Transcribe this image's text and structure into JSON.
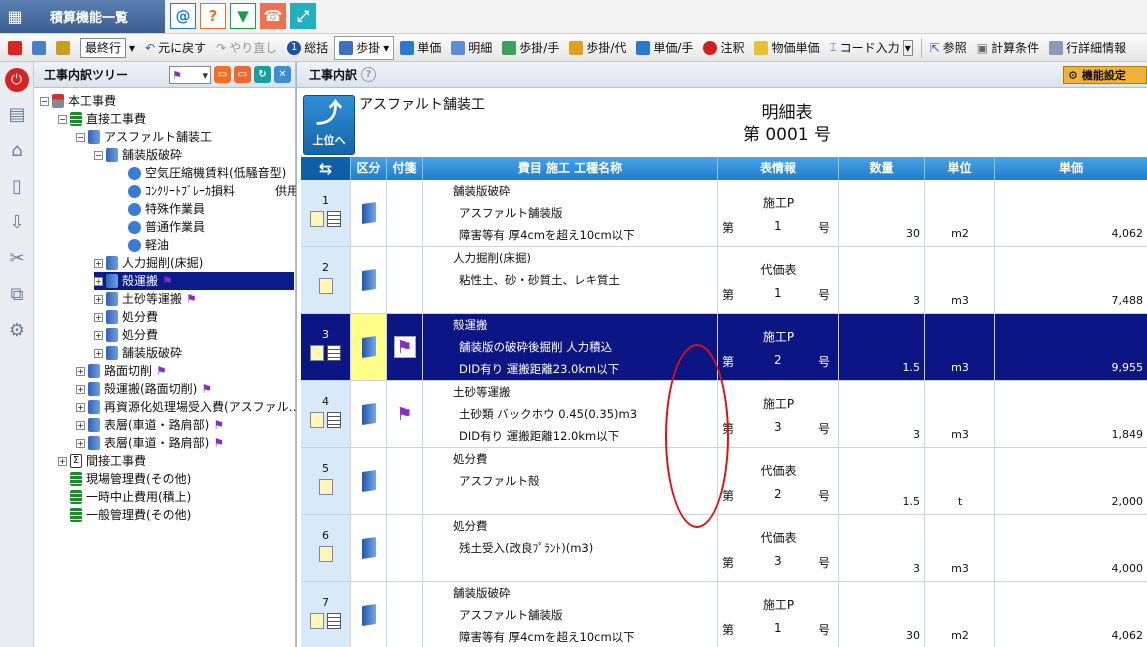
{
  "app": {
    "title": "積算機能一覧"
  },
  "toolbar": {
    "sel": "最終行",
    "undo": "元に戻す",
    "redo": "やり直し",
    "total": "総括",
    "ayumi": "歩掛",
    "tanka": "単価",
    "meisai": "明細",
    "ayumi_hand": "歩掛/手",
    "ayumi_dai": "歩掛/代",
    "tanka_hand": "単価/手",
    "chuushaku": "注釈",
    "buppin": "物価単価",
    "code_input": "コード入力",
    "sansho": "参照",
    "keisan": "計算条件",
    "gyoshosai": "行詳細情報"
  },
  "tree": {
    "header": "工事内訳ツリー",
    "nodes": [
      {
        "label": "本工事費"
      },
      {
        "label": "直接工事費"
      },
      {
        "label": "アスファルト舗装工"
      },
      {
        "label": "舗装版破砕"
      },
      {
        "label": "空気圧縮機賃料(低騒音型)"
      },
      {
        "label": "ｺﾝｸﾘｰﾄﾌﾞﾚｰｶ損料"
      },
      {
        "label": "特殊作業員"
      },
      {
        "label": "普通作業員"
      },
      {
        "label": "軽油"
      },
      {
        "label": "人力掘削(床掘)"
      },
      {
        "label": "殻運搬"
      },
      {
        "label": "土砂等運搬"
      },
      {
        "label": "処分費"
      },
      {
        "label": "処分費"
      },
      {
        "label": "舗装版破砕"
      },
      {
        "label": "路面切削"
      },
      {
        "label": "殻運搬(路面切削)"
      },
      {
        "label": "再資源化処理場受入費(アスファル…"
      },
      {
        "label": "表層(車道・路肩部)"
      },
      {
        "label": "表層(車道・路肩部)"
      },
      {
        "label": "間接工事費"
      },
      {
        "label": "現場管理費(その他)"
      },
      {
        "label": "一時中止費用(積上)"
      },
      {
        "label": "一般管理費(その他)"
      }
    ],
    "extra_suffix": "供用"
  },
  "main": {
    "header": "工事内訳",
    "kinou": "機能設定",
    "up_label": "上位へ",
    "sheet_name": "アスファルト舗装工",
    "sheet_title1": "明細表",
    "sheet_title2": "第 0001 号",
    "columns": {
      "swap": "⇆",
      "kubun": "区分",
      "fusen": "付箋",
      "name": "費目 施工 工種名称",
      "info": "表情報",
      "qty": "数量",
      "unit": "単位",
      "price": "単価"
    },
    "rows": [
      {
        "no": "1",
        "l1": "舗装版破砕",
        "l2": "アスファルト舗装版",
        "l3": "障害等有 厚4cmを超え10cm以下",
        "kind": "施工P",
        "dai": "第",
        "num": "1",
        "go": "号",
        "qty": "30",
        "unit": "m2",
        "price": "4,062"
      },
      {
        "no": "2",
        "l1": "人力掘削(床掘)",
        "l2": "",
        "l3": "粘性土、砂・砂質土、レキ質土",
        "kind": "代価表",
        "dai": "第",
        "num": "1",
        "go": "号",
        "qty": "3",
        "unit": "m3",
        "price": "7,488"
      },
      {
        "no": "3",
        "l1": "殻運搬",
        "l2": "舗装版の破砕後掘削 人力積込",
        "l3": "DID有り 運搬距離23.0km以下",
        "kind": "施工P",
        "dai": "第",
        "num": "2",
        "go": "号",
        "qty": "1.5",
        "unit": "m3",
        "price": "9,955"
      },
      {
        "no": "4",
        "l1": "土砂等運搬",
        "l2": "土砂類 バックホウ 0.45(0.35)m3",
        "l3": "DID有り 運搬距離12.0km以下",
        "kind": "施工P",
        "dai": "第",
        "num": "3",
        "go": "号",
        "qty": "3",
        "unit": "m3",
        "price": "1,849"
      },
      {
        "no": "5",
        "l1": "処分費",
        "l2": "",
        "l3": "アスファルト殻",
        "kind": "代価表",
        "dai": "第",
        "num": "2",
        "go": "号",
        "qty": "1.5",
        "unit": "t",
        "price": "2,000"
      },
      {
        "no": "6",
        "l1": "処分費",
        "l2": "残土受入(改良ﾌﾟﾗﾝﾄ)(m3)",
        "l3": "",
        "kind": "代価表",
        "dai": "第",
        "num": "3",
        "go": "号",
        "qty": "3",
        "unit": "m3",
        "price": "4,000"
      },
      {
        "no": "7",
        "l1": "舗装版破砕",
        "l2": "アスファルト舗装版",
        "l3": "障害等有 厚4cmを超え10cm以下",
        "kind": "施工P",
        "dai": "第",
        "num": "1",
        "go": "号",
        "qty": "30",
        "unit": "m2",
        "price": "4,062"
      }
    ]
  }
}
